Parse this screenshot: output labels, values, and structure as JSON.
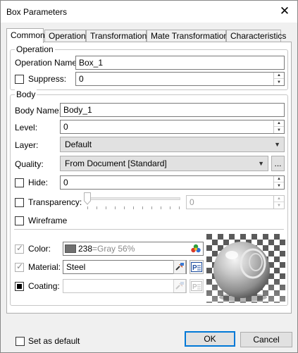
{
  "window": {
    "title": "Box Parameters",
    "close_icon": "close-icon"
  },
  "tabs": [
    {
      "label": "Common",
      "active": true
    },
    {
      "label": "Operation"
    },
    {
      "label": "Transformations"
    },
    {
      "label": "Mate Transformations"
    },
    {
      "label": "Characteristics"
    }
  ],
  "operation": {
    "legend": "Operation",
    "name_label": "Operation Name:",
    "name_value": "Box_1",
    "suppress_label": "Suppress:",
    "suppress_value": "0"
  },
  "body": {
    "legend": "Body",
    "name_label": "Body Name:",
    "name_value": "Body_1",
    "level_label": "Level:",
    "level_value": "0",
    "layer_label": "Layer:",
    "layer_value": "Default",
    "quality_label": "Quality:",
    "quality_value": "From Document [Standard]",
    "quality_more": "...",
    "hide_label": "Hide:",
    "hide_value": "0",
    "transparency_label": "Transparency:",
    "transparency_value": "0",
    "wireframe_label": "Wireframe",
    "color_label": "Color:",
    "color_value_num": "238",
    "color_value_text": "=Gray 56%",
    "color_swatch": "#707070",
    "material_label": "Material:",
    "material_value": "Steel",
    "coating_label": "Coating:",
    "coating_value": ""
  },
  "footer": {
    "set_default_label": "Set as default",
    "ok_label": "OK",
    "cancel_label": "Cancel"
  },
  "colors": {
    "accent": "#0078d7"
  }
}
